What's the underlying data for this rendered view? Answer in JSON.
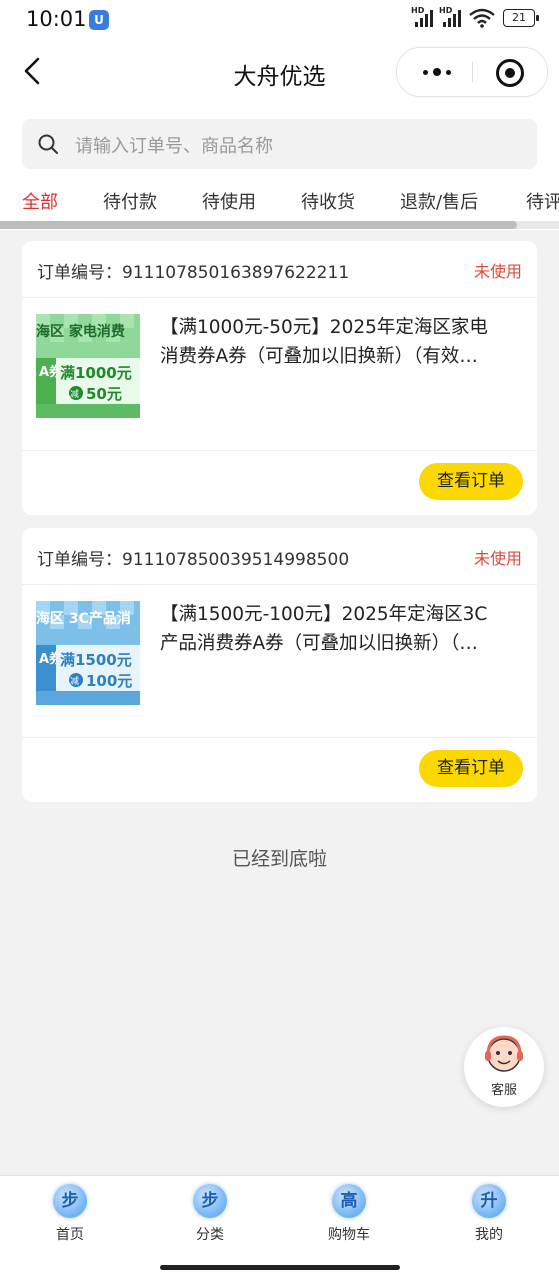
{
  "status_bar": {
    "time": "10:01",
    "app_badge": "U",
    "signal_1": "HD",
    "signal_2": "HD",
    "battery": "21"
  },
  "nav": {
    "title": "大舟优选"
  },
  "search": {
    "placeholder": "请输入订单号、商品名称"
  },
  "tabs": [
    "全部",
    "待付款",
    "待使用",
    "待收货",
    "退款/售后",
    "待评"
  ],
  "active_tab": 0,
  "orders": [
    {
      "order_label": "订单编号：",
      "order_no": "911107850163897622211",
      "status": "未使用",
      "thumb": {
        "top": "海区 家电消费",
        "side": "A券",
        "line1": "满1000元",
        "badge": "减",
        "line2": "50元",
        "color": "#7fcf86"
      },
      "title_line1": "【满1000元-50元】2025年定海区家电",
      "title_line2": "消费券A券（可叠加以旧换新）（有效…",
      "button": "查看订单"
    },
    {
      "order_label": "订单编号：",
      "order_no": "911107850039514998500",
      "status": "未使用",
      "thumb": {
        "top": "海区 3C产品消",
        "side": "A券",
        "line1": "满1500元",
        "badge": "减",
        "line2": "100元",
        "color": "#6fb6e3"
      },
      "title_line1": "【满1500元-100元】2025年定海区3C",
      "title_line2": "产品消费券A券（可叠加以旧换新）（…",
      "button": "查看订单"
    }
  ],
  "bottom_tip": "已经到底啦",
  "customer_service": {
    "label": "客服"
  },
  "tabbar": [
    {
      "label": "首页",
      "glyph": "步"
    },
    {
      "label": "分类",
      "glyph": "步"
    },
    {
      "label": "购物车",
      "glyph": "高"
    },
    {
      "label": "我的",
      "glyph": "升"
    }
  ]
}
